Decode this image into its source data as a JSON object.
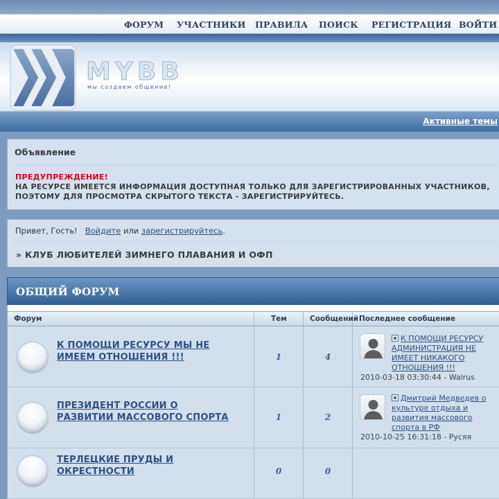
{
  "nav": {
    "items": [
      "ФОРУМ",
      "УЧАСТНИКИ",
      "ПРАВИЛА",
      "ПОИСК",
      "РЕГИСТРАЦИЯ",
      "ВОЙТИ"
    ]
  },
  "logo": {
    "name": "MYBB",
    "slogan": "мы создаем общение!"
  },
  "subbar": {
    "active_topics": "Активные темы"
  },
  "announcement": {
    "title": "Объявление",
    "warning_head": "ПРЕДУПРЕЖДЕНИЕ!",
    "warning_body": "НА РЕСУРСЕ ИМЕЕТСЯ ИНФОРМАЦИЯ ДОСТУПНАЯ ТОЛЬКО ДЛЯ ЗАРЕГИСТРИРОВАННЫХ УЧАСТНИКОВ, ПОЭТОМУ ДЛЯ ПРОСМОТРА СКРЫТОГО ТЕКСТА - ЗАРЕГИСТРИРУЙТЕСЬ."
  },
  "welcome": {
    "greeting": "Привет, Гость!",
    "login": "Войдите",
    "or": "или",
    "register": "зарегистрируйтесь",
    "dot": ".",
    "breadcrumb_prefix": "»",
    "breadcrumb": "КЛУБ ЛЮБИТЕЛЕЙ ЗИМНЕГО ПЛАВАНИЯ И ОФП"
  },
  "forum_section": {
    "title": "ОБЩИЙ ФОРУМ",
    "columns": {
      "forum": "Форум",
      "topics": "Тем",
      "posts": "Сообщений",
      "last_post": "Последнее сообщение"
    },
    "rows": [
      {
        "title": "К ПОМОЩИ РЕСУРСУ МЫ НЕ ИМЕЕМ ОТНОШЕНИЯ !!!",
        "topics": "1",
        "posts": "4",
        "last_title": "К ПОМОЩИ РЕСУРСУ АДМИНИСТРАЦИЯ НЕ ИМЕЕТ НИКАКОГО ОТНОШЕНИЯ !!!",
        "last_meta": "2010-03-18 03:30:44 - Walrus"
      },
      {
        "title": "ПРЕЗИДЕНТ РОССИИ О РАЗВИТИИ МАССОВОГО СПОРТА",
        "topics": "1",
        "posts": "2",
        "last_title": "Дмитрий Медведев о культуре отдыха и развития массового спорта в РФ",
        "last_meta": "2010-10-25 16:31:18 - Русяя"
      },
      {
        "title": "ТЕРЛЕЦКИЕ ПРУДЫ И ОКРЕСТНОСТИ",
        "topics": "0",
        "posts": "0"
      }
    ]
  },
  "colors": {
    "link": "#2b5184",
    "warning": "#e0001a",
    "header_bar": "#3f6b9f"
  }
}
